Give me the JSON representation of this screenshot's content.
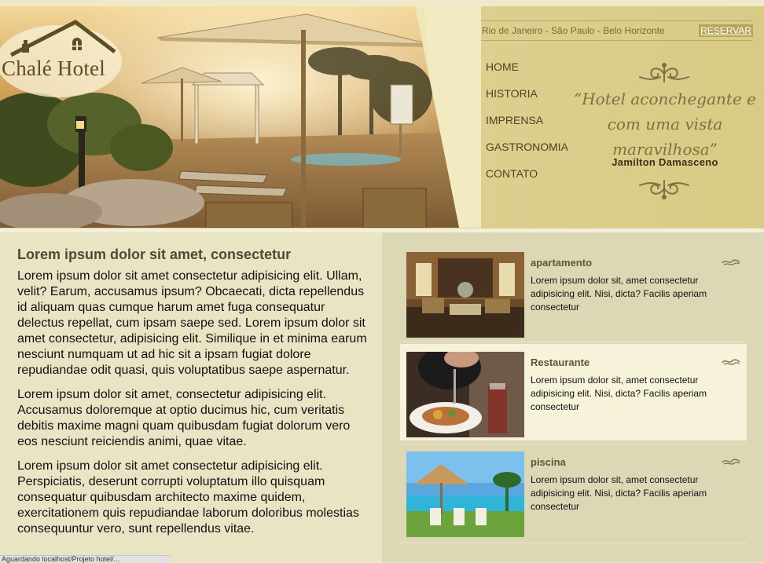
{
  "header": {
    "logo_text": "Chalé Hotel",
    "cities": "Rio de Janeiro - São Paulo - Belo Horizonte",
    "reserve_label": "RESERVAR",
    "nav": [
      "HOME",
      "HISTORIA",
      "IMPRENSA",
      "GASTRONOMIA",
      "CONTATO"
    ],
    "quote": "“Hotel aconchegante e com uma vista maravilhosa”",
    "quote_author": "Jamilton Damasceno"
  },
  "main": {
    "title": "Lorem ipsum dolor sit amet, consectetur",
    "paragraphs": [
      "Lorem ipsum dolor sit amet consectetur adipisicing elit. Ullam, velit? Earum, accusamus ipsum? Obcaecati, dicta repellendus id aliquam quas cumque harum amet fuga consequatur delectus repellat, cum ipsam saepe sed. Lorem ipsum dolor sit amet consectetur, adipisicing elit. Similique in et minima earum nesciunt numquam ut ad hic sit a ipsam fugiat dolore repudiandae odit quasi, quis voluptatibus saepe aspernatur.",
      "Lorem ipsum dolor sit amet, consectetur adipisicing elit. Accusamus doloremque at optio ducimus hic, cum veritatis debitis maxime magni quam quibusdam fugiat dolorum vero eos nesciunt reiciendis animi, quae vitae.",
      "Lorem ipsum dolor sit amet consectetur adipisicing elit. Perspiciatis, deserunt corrupti voluptatum illo quisquam consequatur quibusdam architecto maxime quidem, exercitationem quis repudiandae laborum doloribus molestias consequuntur vero, sunt repellendus vitae."
    ]
  },
  "sidebar": {
    "cards": [
      {
        "title": "apartamento",
        "text": "Lorem ipsum dolor sit, amet consectetur adipisicing elit. Nisi, dicta? Facilis aperiam consectetur"
      },
      {
        "title": "Restaurante",
        "text": "Lorem ipsum dolor sit, amet consectetur adipisicing elit. Nisi, dicta? Facilis aperiam consectetur"
      },
      {
        "title": "piscina",
        "text": "Lorem ipsum dolor sit, amet consectetur adipisicing elit. Nisi, dicta? Facilis aperiam consectetur"
      }
    ]
  },
  "status_bar": "Aguardando localhost/Projeto hotel/...",
  "colors": {
    "gold_panel": "#ddd08e",
    "main_bg": "#e9e4c3",
    "sidebar_bg": "#dcd7b5",
    "highlight_card": "#f7f2da",
    "reserve_bg": "#b3a65a"
  },
  "icons": [
    "house-roof-logo-icon",
    "flourish-ornament-icon",
    "scroll-ornament-icon"
  ]
}
